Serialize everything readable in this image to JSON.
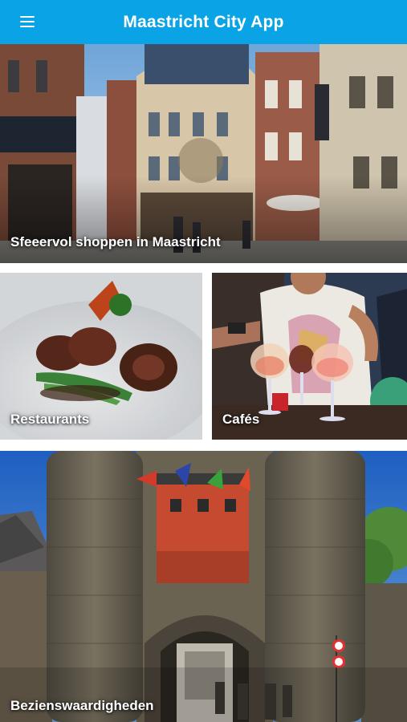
{
  "header": {
    "title": "Maastricht City App",
    "menu_icon": "hamburger-menu-icon",
    "background": "#0aa3e6"
  },
  "tiles": [
    {
      "label": "Sfeeervol shoppen in Maastricht",
      "image": "shopping-street-photo"
    },
    {
      "label": "Restaurants",
      "image": "restaurant-dish-photo"
    },
    {
      "label": "Cafés",
      "image": "cafe-drinks-photo"
    },
    {
      "label": "Bezienswaardigheden",
      "image": "helpoort-city-gate-photo"
    }
  ]
}
